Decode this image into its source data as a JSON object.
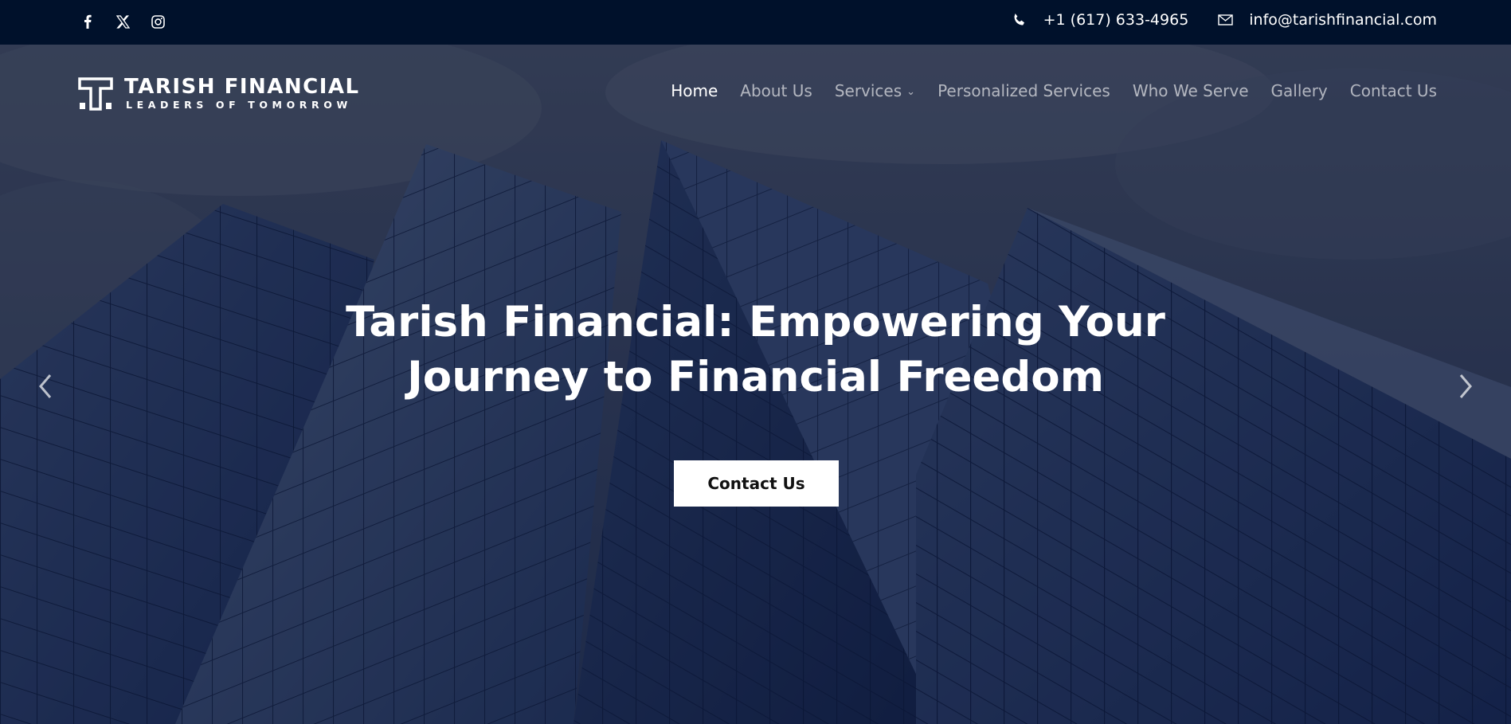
{
  "topbar": {
    "social": [
      {
        "icon": "facebook-icon"
      },
      {
        "icon": "x-twitter-icon"
      },
      {
        "icon": "instagram-icon"
      }
    ],
    "phone": "+1 (617) 633-4965",
    "email": "info@tarishfinancial.com"
  },
  "logo": {
    "name": "TARISH FINANCIAL",
    "tagline": "LEADERS OF TOMORROW"
  },
  "nav": {
    "items": [
      {
        "label": "Home",
        "active": true
      },
      {
        "label": "About Us"
      },
      {
        "label": "Services",
        "has_dropdown": true
      },
      {
        "label": "Personalized Services"
      },
      {
        "label": "Who We Serve"
      },
      {
        "label": "Gallery"
      },
      {
        "label": "Contact Us"
      }
    ]
  },
  "hero": {
    "headline_line1": "Tarish Financial: Empowering Your",
    "headline_line2": "Journey to Financial Freedom",
    "cta_label": "Contact Us"
  },
  "colors": {
    "topbar_bg": "#00112b",
    "overlay": "#0b1a3d",
    "text": "#ffffff"
  }
}
